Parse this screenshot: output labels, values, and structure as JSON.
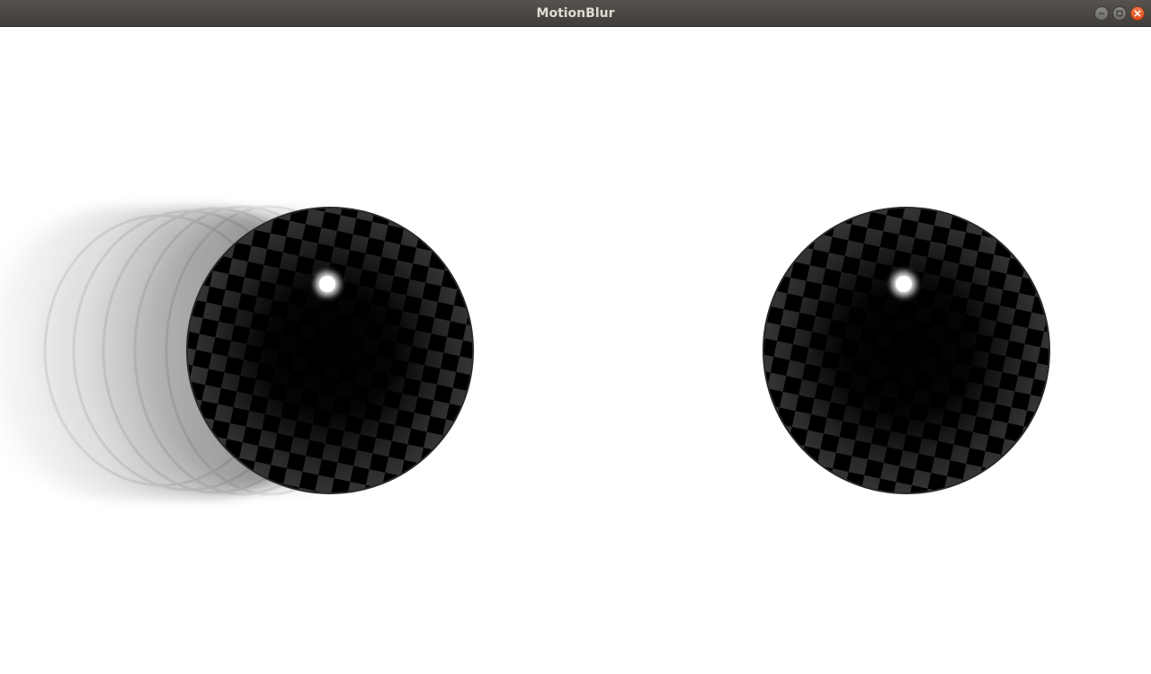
{
  "window": {
    "title": "MotionBlur",
    "controls": {
      "minimize_icon": "minimize-icon",
      "maximize_icon": "maximize-icon",
      "close_icon": "close-icon"
    }
  },
  "scene": {
    "background_color": "#ffffff",
    "sphere_color": "#000000",
    "checker_color": "#3a3a3a",
    "highlight_color": "#ffffff",
    "objects": [
      {
        "name": "blurred-sphere",
        "motion_blur": true
      },
      {
        "name": "static-sphere",
        "motion_blur": false
      }
    ]
  }
}
